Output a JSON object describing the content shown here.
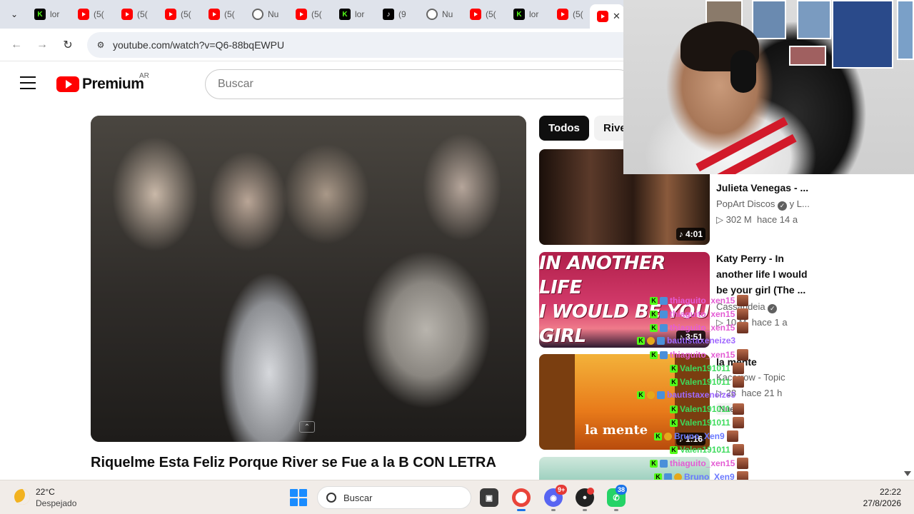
{
  "browser": {
    "tabs": [
      {
        "icon": "kick",
        "label": "lor"
      },
      {
        "icon": "youtube",
        "label": "(5("
      },
      {
        "icon": "youtube",
        "label": "(5("
      },
      {
        "icon": "youtube",
        "label": "(5("
      },
      {
        "icon": "youtube",
        "label": "(5("
      },
      {
        "icon": "circle",
        "label": "Nu"
      },
      {
        "icon": "youtube",
        "label": "(5("
      },
      {
        "icon": "kick",
        "label": "lor"
      },
      {
        "icon": "tiktok",
        "label": "(9"
      },
      {
        "icon": "circle",
        "label": "Nu"
      },
      {
        "icon": "youtube",
        "label": "(5("
      },
      {
        "icon": "kick",
        "label": "lor"
      },
      {
        "icon": "youtube",
        "label": "(5("
      }
    ],
    "active_tab_close": "✕",
    "url": "youtube.com/watch?v=Q6-88bqEWPU"
  },
  "youtube": {
    "logo_text": "Premium",
    "region": "AR",
    "search_placeholder": "Buscar",
    "video_title": "Riquelme Esta Feliz Porque River se Fue a la B CON LETRA",
    "chips": [
      "Todos",
      "Rive"
    ],
    "recommendations": [
      {
        "title": "Julieta Venegas - ...",
        "channel": "PopArt Discos",
        "channel_suffix": "y L...",
        "views": "302 M",
        "age": "hace 14 a",
        "duration": "4:01"
      },
      {
        "title": "Katy Perry - In another life I would be your girl (The ...",
        "channel": "Cassandeia",
        "views": "10 M",
        "age": "hace 1 a",
        "duration": "3:51",
        "thumb_text": [
          "IN ANOTHER LIFE",
          "I WOULD BE YOU GIRL"
        ]
      },
      {
        "title": "la mente",
        "channel": "Kacorrow - Topic",
        "views": "28",
        "age": "hace 21 h",
        "duration": "1:16",
        "thumb_text": "la mente",
        "badge": "Nue"
      },
      {
        "title": "",
        "channel": "",
        "views": "",
        "age": "",
        "duration": ""
      }
    ]
  },
  "chat": [
    {
      "user": "thiaguito_xen15",
      "color": "pink"
    },
    {
      "user": "thiaguito_xen15",
      "color": "pink"
    },
    {
      "user": "thiaguito_xen15",
      "color": "pink"
    },
    {
      "user": "bautistaxeneize3",
      "color": "purple"
    },
    {
      "user": "thiaguito_xen15",
      "color": "pink"
    },
    {
      "user": "Valen191011",
      "color": "green"
    },
    {
      "user": "Valen191011",
      "color": "green"
    },
    {
      "user": "bautistaxeneize3",
      "color": "purple"
    },
    {
      "user": "Valen191011",
      "color": "green"
    },
    {
      "user": "Valen191011",
      "color": "green"
    },
    {
      "user": "Bruno_Xen9",
      "color": "blue"
    },
    {
      "user": "Valen191011",
      "color": "green"
    },
    {
      "user": "thiaguito_xen15",
      "color": "pink"
    },
    {
      "user": "Bruno_Xen9",
      "color": "blue"
    },
    {
      "user": "Bruno_Xen9",
      "color": "blue"
    },
    {
      "user": "Bruno_Xen9",
      "color": "blue"
    }
  ],
  "taskbar": {
    "weather_temp": "22°C",
    "weather_condition": "Despejado",
    "search_label": "Buscar",
    "discord_badge": "9+",
    "whatsapp_badge": "38",
    "time": "22:22",
    "date": "27/8/2026"
  }
}
